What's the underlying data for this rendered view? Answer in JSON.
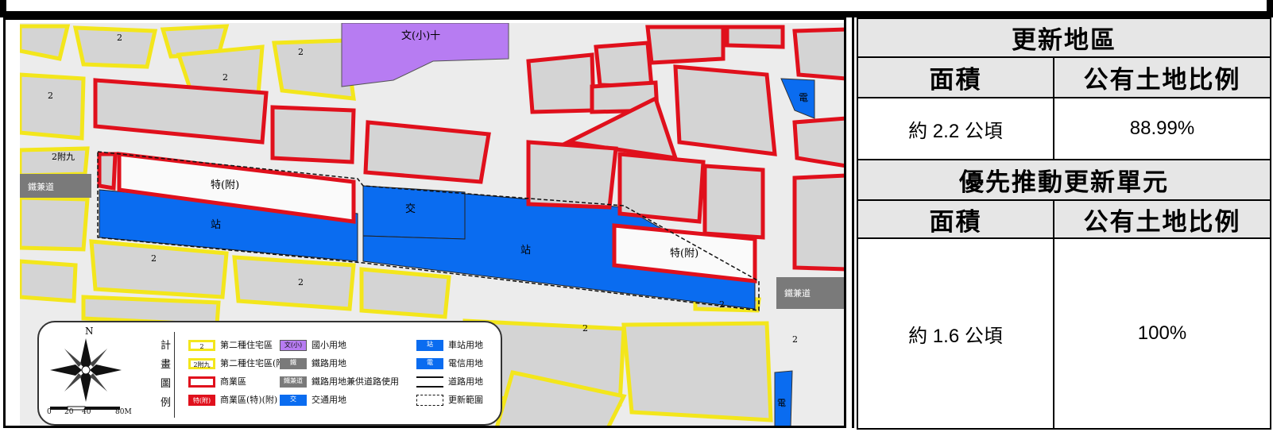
{
  "table": {
    "renewal_area_title": "更新地區",
    "col_area": "面積",
    "col_public_ratio": "公有土地比例",
    "renewal_area_size": "約 2.2 公頃",
    "renewal_area_ratio": "88.99%",
    "priority_unit_title": "優先推動更新單元",
    "priority_col_area": "面積",
    "priority_col_public_ratio": "公有土地比例",
    "priority_unit_size": "約 1.6 公頃",
    "priority_unit_ratio": "100%"
  },
  "map": {
    "labels": {
      "school": "文(小)十",
      "special_left": "特(附)",
      "special_right": "特(附)",
      "station_left": "站",
      "station_mid": "站",
      "transport": "交",
      "rail_road_left": "鐵兼道",
      "rail_road_right": "鐵兼道",
      "telecom_top": "電",
      "telecom_bottom": "電",
      "zone2": "2",
      "zone2_9": "2附九"
    }
  },
  "legend": {
    "title": "計畫圖例",
    "north": "N",
    "scale": [
      "0",
      "20",
      "40",
      "80M"
    ],
    "items": [
      {
        "swatch": "2",
        "label": "第二種住宅區",
        "kind": "res"
      },
      {
        "swatch": "2附九",
        "label": "第二種住宅區(附九)",
        "kind": "res"
      },
      {
        "swatch": "",
        "label": "商業區",
        "kind": "com"
      },
      {
        "swatch": "特(附)",
        "label": "商業區(特)(附)",
        "kind": "comsp"
      },
      {
        "swatch": "文(小)",
        "label": "國小用地",
        "kind": "school"
      },
      {
        "swatch": "鐵",
        "label": "鐵路用地",
        "kind": "rail"
      },
      {
        "swatch": "鐵兼道",
        "label": "鐵路用地兼供道路使用",
        "kind": "rail"
      },
      {
        "swatch": "交",
        "label": "交通用地",
        "kind": "blue"
      },
      {
        "swatch": "站",
        "label": "車站用地",
        "kind": "blue"
      },
      {
        "swatch": "電",
        "label": "電信用地",
        "kind": "blue"
      },
      {
        "swatch": "",
        "label": "道路用地",
        "kind": "road"
      },
      {
        "swatch": "",
        "label": "更新範圍",
        "kind": "dash"
      }
    ]
  },
  "colors": {
    "residential_fill": "#d9d9d9",
    "residential_border": "#f5ea1a",
    "commercial_border": "#e0101c",
    "station_blue": "#0a6cf0",
    "school_purple": "#b77cf2",
    "rail_gray": "#7a7a7a"
  }
}
